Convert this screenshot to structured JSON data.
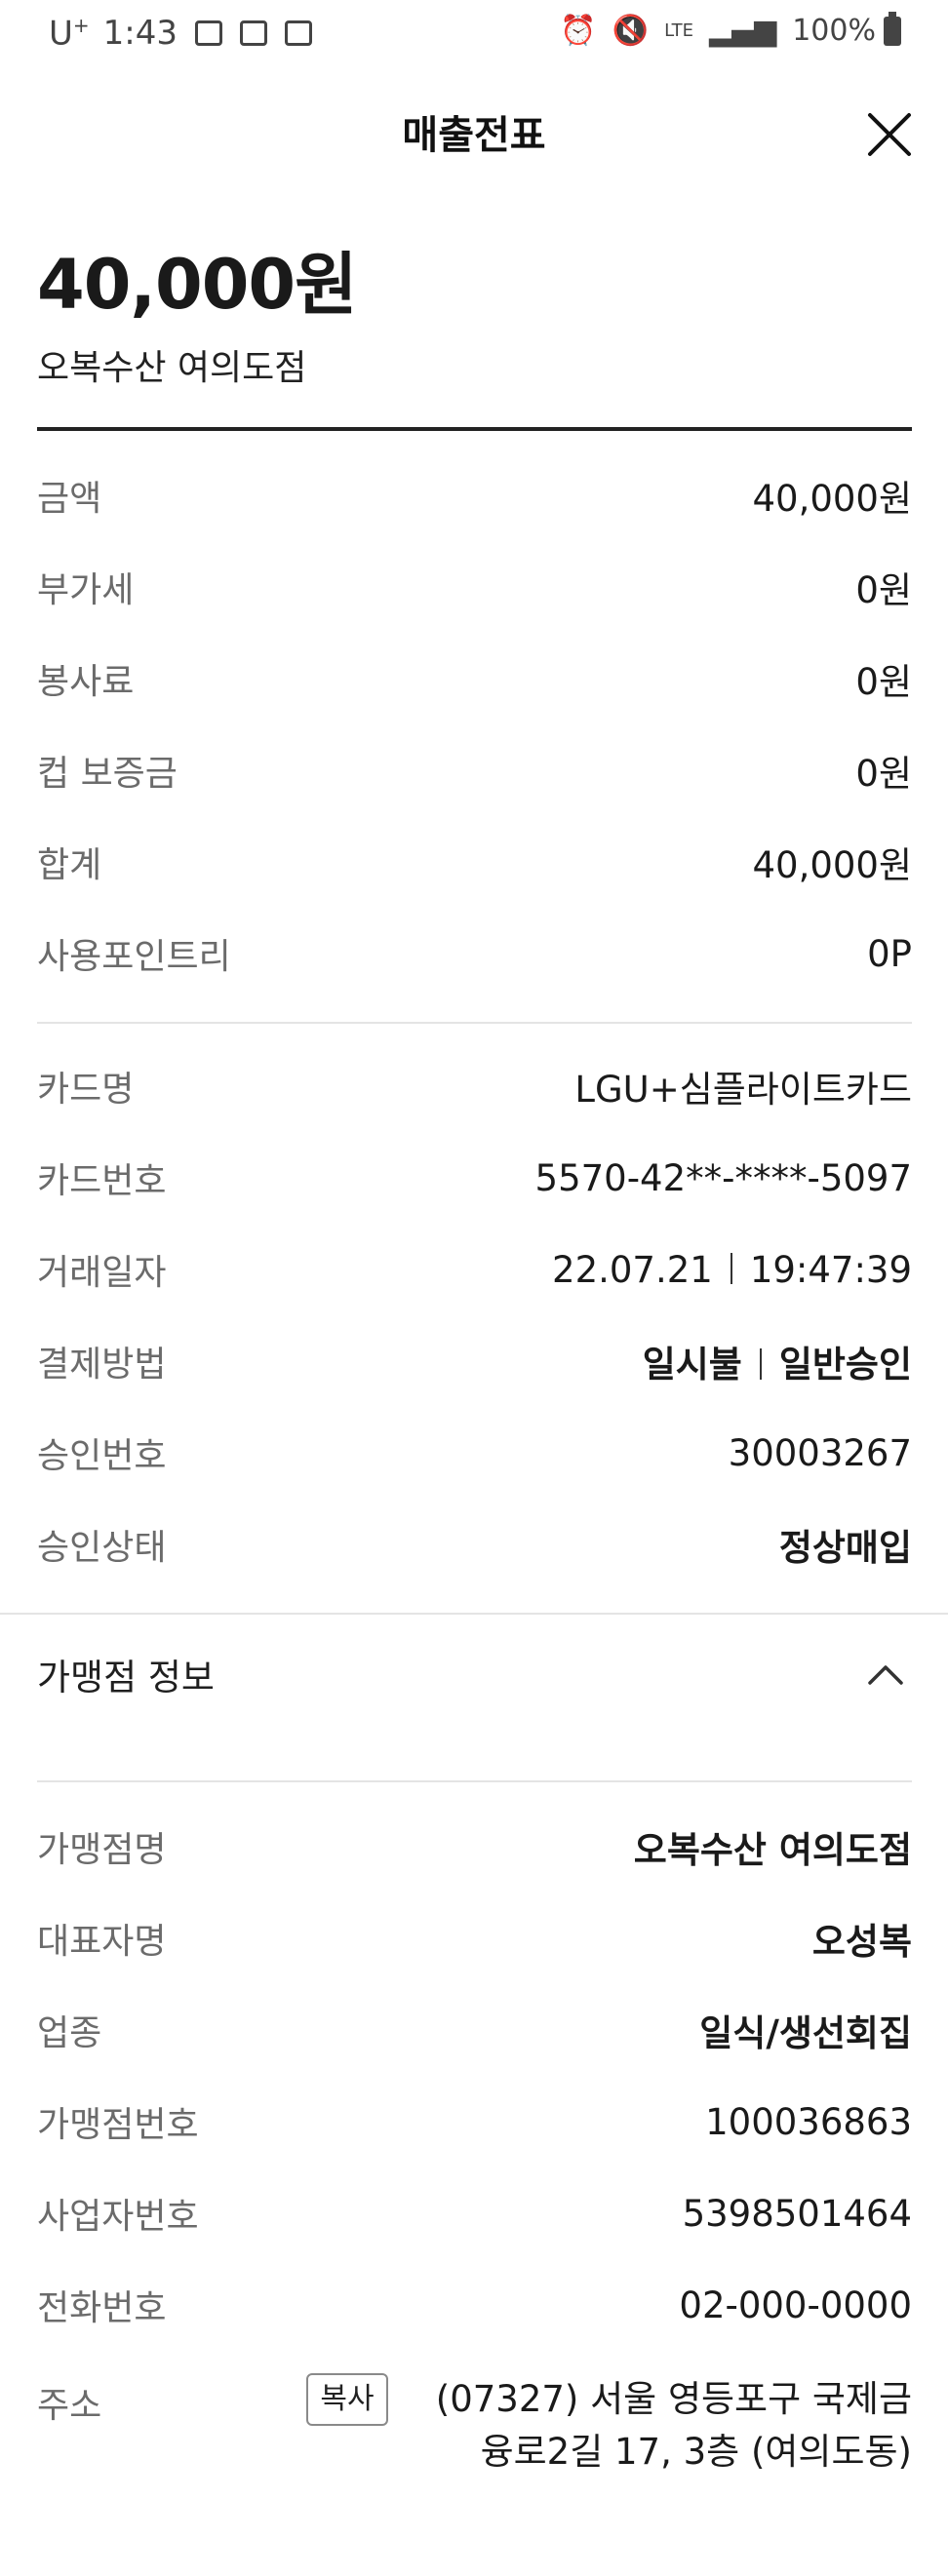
{
  "status_bar": {
    "carrier": "U",
    "carrier_sup": "+",
    "time": "1:43",
    "network": "LTE",
    "battery": "100%"
  },
  "header": {
    "title": "매출전표"
  },
  "summary": {
    "amount": "40,000원",
    "store": "오복수산 여의도점"
  },
  "amounts": [
    {
      "label": "금액",
      "value": "40,000원"
    },
    {
      "label": "부가세",
      "value": "0원"
    },
    {
      "label": "봉사료",
      "value": "0원"
    },
    {
      "label": "컵 보증금",
      "value": "0원"
    },
    {
      "label": "합계",
      "value": "40,000원"
    },
    {
      "label": "사용포인트리",
      "value": "0P"
    }
  ],
  "card": {
    "name_label": "카드명",
    "name_value": "LGU+심플라이트카드",
    "number_label": "카드번호",
    "number_value": "5570-42**-****-5097",
    "date_label": "거래일자",
    "date_value": "22.07.21",
    "time_value": "19:47:39",
    "method_label": "결제방법",
    "method_value": "일시불",
    "method_type": "일반승인",
    "approval_label": "승인번호",
    "approval_value": "30003267",
    "status_label": "승인상태",
    "status_value": "정상매입"
  },
  "merchant": {
    "section_title": "가맹점 정보",
    "rows": [
      {
        "label": "가맹점명",
        "value": "오복수산 여의도점"
      },
      {
        "label": "대표자명",
        "value": "오성복"
      },
      {
        "label": "업종",
        "value": "일식/생선회집"
      },
      {
        "label": "가맹점번호",
        "value": "100036863"
      },
      {
        "label": "사업자번호",
        "value": "5398501464"
      },
      {
        "label": "전화번호",
        "value": "02-000-0000"
      }
    ],
    "address_label": "주소",
    "copy_label": "복사",
    "address_value": "(07327) 서울 영등포구 국제금융로2길 17, 3층 (여의도동)"
  }
}
